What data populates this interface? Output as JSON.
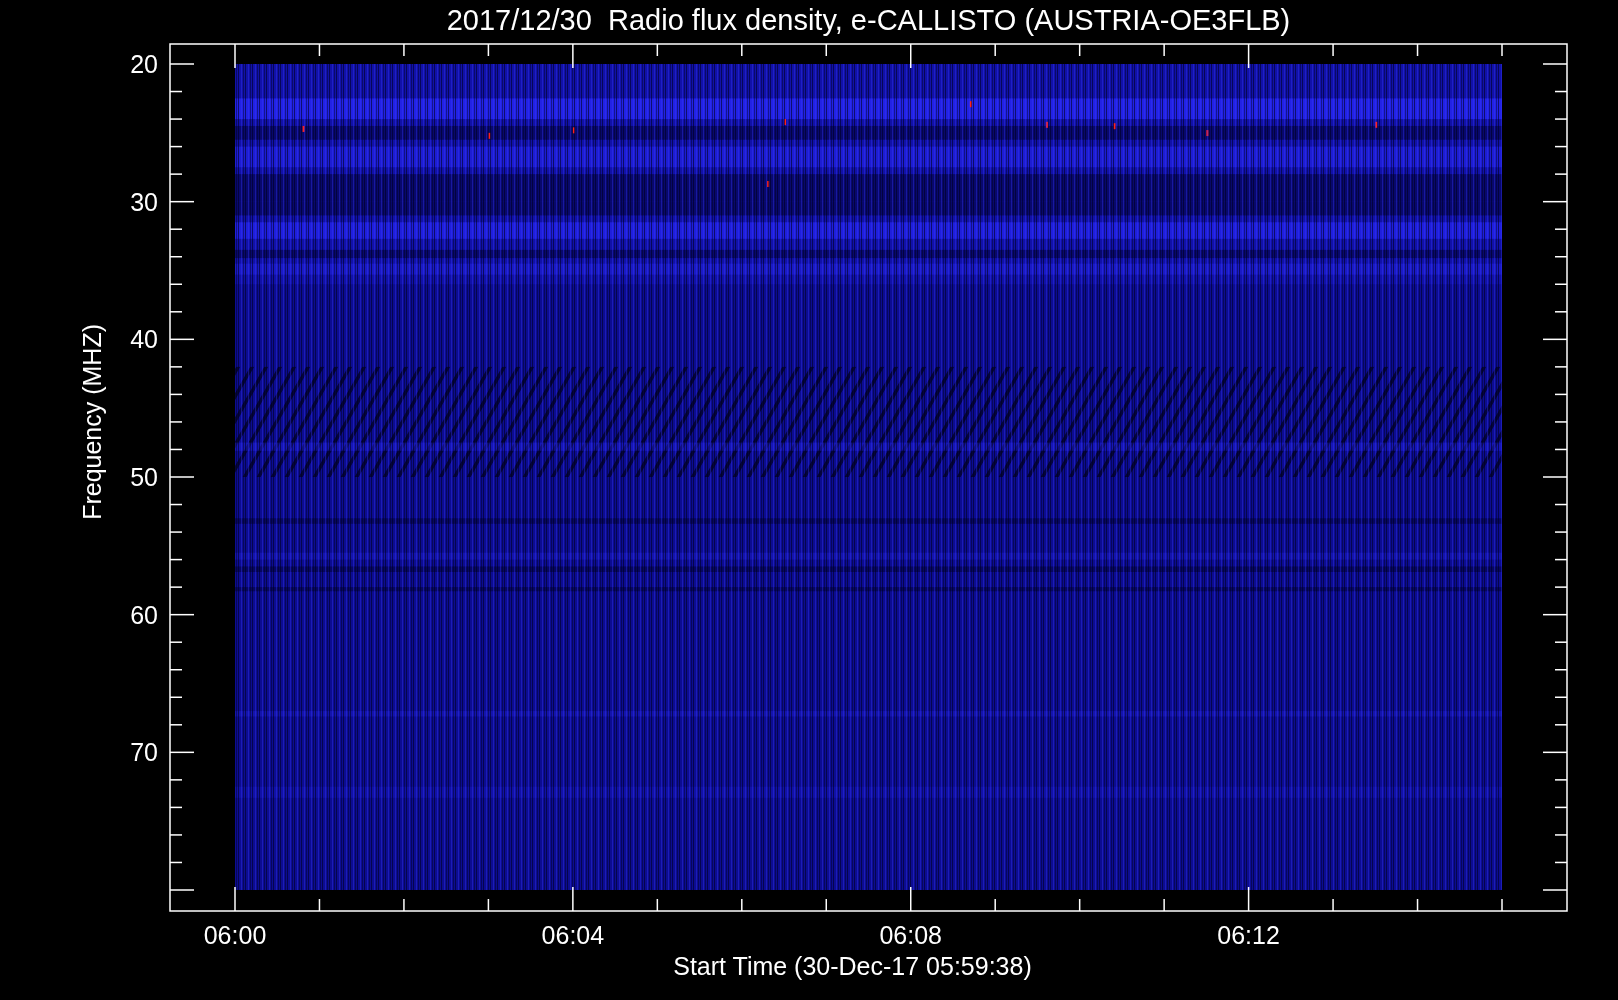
{
  "title": "2017/12/30  Radio flux density, e-CALLISTO (AUSTRIA-OE3FLB)",
  "y_axis": {
    "label": "Frequency (MHZ)",
    "ticks": [
      "20",
      "30",
      "40",
      "50",
      "60",
      "70"
    ]
  },
  "x_axis": {
    "label": "Start Time (30-Dec-17 05:59:38)",
    "ticks": [
      "06:00",
      "06:04",
      "06:08",
      "06:12"
    ]
  }
}
